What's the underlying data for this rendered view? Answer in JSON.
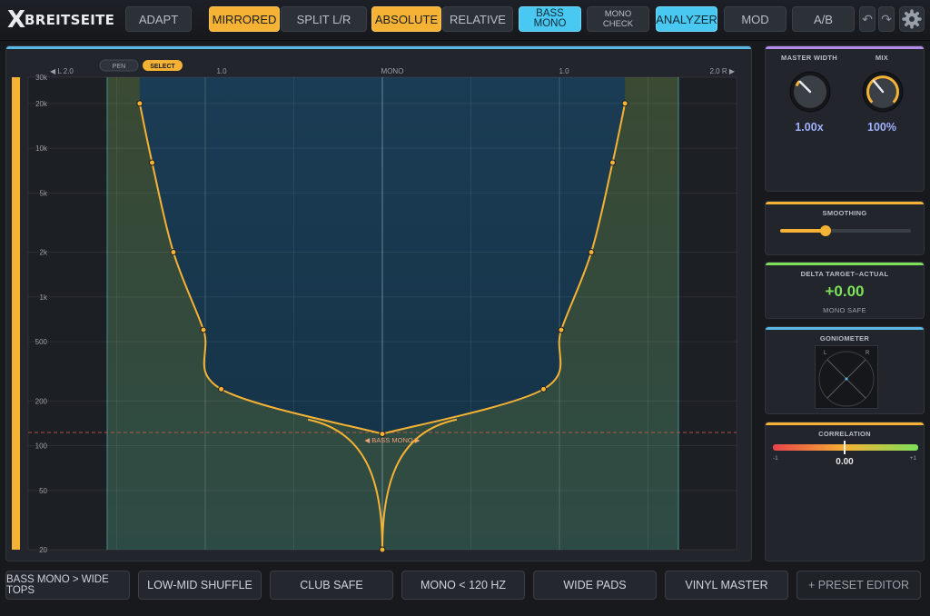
{
  "app": {
    "logo_mark": "X",
    "logo_text": "BREITSEITE"
  },
  "toolbar": {
    "adapt": "ADAPT",
    "mirrored": "MIRRORED",
    "split_lr": "SPLIT L/R",
    "absolute": "ABSOLUTE",
    "relative": "RELATIVE",
    "bass_mono": "BASS MONO",
    "mono_check_line1": "MONO",
    "mono_check_line2": "CHECK",
    "analyzer": "ANALYZER",
    "mod": "MOD",
    "ab": "A/B",
    "undo_icon": "↶",
    "redo_icon": "↷"
  },
  "graph": {
    "tool_pen": "PEN",
    "tool_select": "SELECT",
    "x_axis": {
      "left_label": "◀ L 2.0",
      "left_mid": "1.0",
      "center": "MONO",
      "right_mid": "1.0",
      "right_label": "2.0 R ▶"
    },
    "y_axis_labels": [
      "30k",
      "20k",
      "10k",
      "5k",
      "2k",
      "1k",
      "500",
      "200",
      "100",
      "50",
      "20"
    ],
    "bass_mono_marker": "◀ BASS MONO ▶"
  },
  "chart_data": {
    "type": "line",
    "xlabel": "",
    "ylabel": "",
    "x_range": [
      -2.0,
      2.0
    ],
    "y_scale": "log",
    "y_range_hz": [
      20,
      30000
    ],
    "bass_mono_hz": 120,
    "series": [
      {
        "points": [
          [
            0.0,
            120
          ],
          [
            -0.91,
            240
          ],
          [
            -1.01,
            600
          ],
          [
            -1.18,
            2000
          ],
          [
            -1.3,
            8000
          ],
          [
            -1.37,
            20000
          ]
        ]
      },
      {
        "points": [
          [
            0.0,
            120
          ],
          [
            0.91,
            240
          ],
          [
            1.01,
            600
          ],
          [
            1.18,
            2000
          ],
          [
            1.3,
            8000
          ],
          [
            1.37,
            20000
          ]
        ]
      },
      {
        "points": [
          [
            0.0,
            20
          ]
        ]
      }
    ]
  },
  "side": {
    "master_width": {
      "label": "MASTER WIDTH",
      "value": "1.00x"
    },
    "mix": {
      "label": "MIX",
      "value": "100%"
    },
    "smoothing": {
      "label": "SMOOTHING",
      "value": 0.35
    },
    "delta": {
      "label": "DELTA TARGET–ACTUAL",
      "value": "+0.00",
      "status": "MONO SAFE"
    },
    "goniometer": {
      "label": "GONIOMETER",
      "l": "L",
      "r": "R"
    },
    "correlation": {
      "label": "CORRELATION",
      "value": "0.00",
      "min": "-1",
      "max": "+1"
    }
  },
  "presets": [
    "BASS MONO > WIDE TOPS",
    "LOW-MID SHUFFLE",
    "CLUB SAFE",
    "MONO < 120 HZ",
    "WIDE PADS",
    "VINYL MASTER",
    "+ PRESET EDITOR"
  ],
  "colors": {
    "accent_orange": "#f5b234",
    "accent_cyan": "#49c8f2",
    "delta_green": "#7de05a",
    "knob_value": "#9fb2ff"
  }
}
